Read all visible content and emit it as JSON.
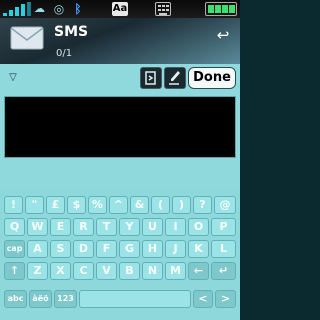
{
  "status_bar": {
    "icons": [
      "signal-strength-icon",
      "data-icon",
      "radio-icon",
      "bluetooth-icon",
      "input-mode-icon",
      "keyboard-icon",
      "battery-icon"
    ],
    "input_mode_label": "Aa"
  },
  "header": {
    "title": "SMS",
    "count": "0/1",
    "back_icon": "back-arrow-icon",
    "app_icon": "envelope-icon"
  },
  "toolbar": {
    "dropdown_icon": "chevron-down-icon",
    "insert_icon": "insert-icon",
    "edit_icon": "pen-icon",
    "done_label": "Done"
  },
  "message": {
    "value": ""
  },
  "keyboard": {
    "row1": [
      "!",
      "\"",
      "£",
      "$",
      "%",
      "^",
      "&",
      "(",
      ")",
      "?",
      "@"
    ],
    "row2": [
      "Q",
      "W",
      "E",
      "R",
      "T",
      "Y",
      "U",
      "I",
      "O",
      "P"
    ],
    "row3": [
      "A",
      "S",
      "D",
      "F",
      "G",
      "H",
      "J",
      "K",
      "L"
    ],
    "row4": [
      "Z",
      "X",
      "C",
      "V",
      "B",
      "N",
      "M"
    ],
    "caps_label": "cap",
    "shift_icon": "↑",
    "backspace_icon": "←",
    "enter_icon": "↵",
    "row5": {
      "abc": "abc",
      "accents": "àëö",
      "numbers": "123",
      "left": "<",
      "right": ">"
    }
  },
  "colors": {
    "accent": "#8fd9dc",
    "key_face": "#9be3e6",
    "text_area": "#000000"
  }
}
